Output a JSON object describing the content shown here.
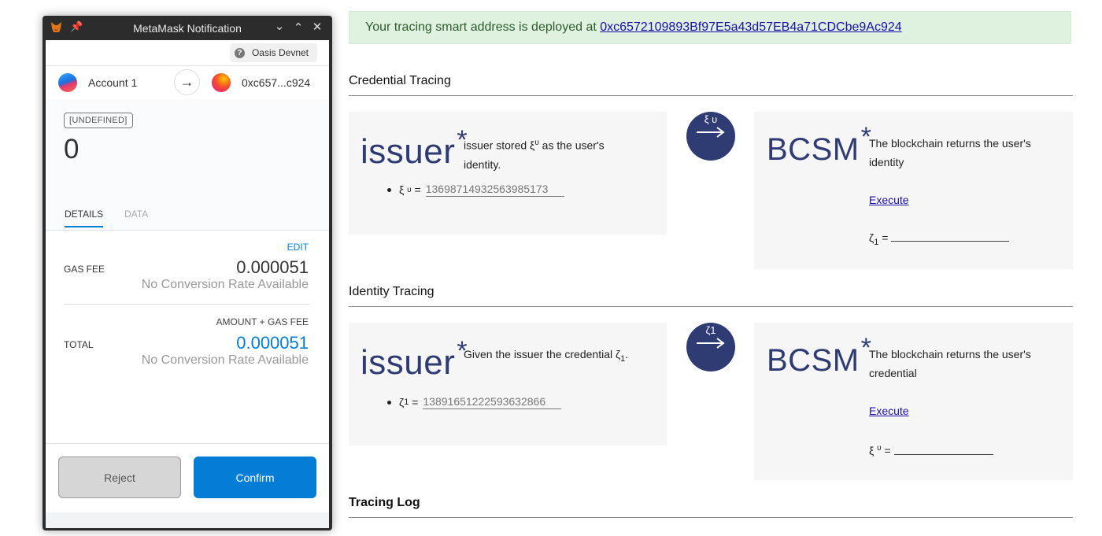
{
  "metamask": {
    "window_title": "MetaMask Notification",
    "network": "Oasis Devnet",
    "from_account": "Account 1",
    "to_address": "0xc657...c924",
    "tx_label": "[UNDEFINED]",
    "amount": "0",
    "tabs": [
      "DETAILS",
      "DATA"
    ],
    "edit_label": "EDIT",
    "gas_fee_label": "GAS FEE",
    "gas_fee_value": "0.000051",
    "no_conversion": "No Conversion Rate Available",
    "amount_gas_label": "AMOUNT + GAS FEE",
    "total_label": "TOTAL",
    "total_value": "0.000051",
    "reject_label": "Reject",
    "confirm_label": "Confirm",
    "accent_color": "#037dd6"
  },
  "alert": {
    "text": "Your tracing smart address is deployed at ",
    "address": "0xc6572109893Bf97E5a43d57EB4a71CDCbe9Ac924"
  },
  "credential": {
    "title": "Credential Tracing",
    "issuer_word": "issuer",
    "star": "*",
    "issuer_text_1": "issuer stored ξ",
    "issuer_sup": "υ",
    "issuer_text_2": " as the user's identity.",
    "bullet_symbol": "ξ",
    "bullet_sup": "υ",
    "bullet_eq": "=",
    "bullet_value": "13698714932563985173",
    "arrow_label": "ξ υ",
    "bcsm_word": "BCSM",
    "bcsm_text": "The blockchain returns the user's identity",
    "execute_label": "Execute",
    "result_symbol": "ζ",
    "result_sub": "1",
    "result_eq": "="
  },
  "identity": {
    "title": "Identity Tracing",
    "issuer_word": "issuer",
    "star": "*",
    "issuer_text_1": "Given the issuer the credential ζ",
    "issuer_sub": "1",
    "issuer_text_2": ".",
    "bullet_symbol": "ζ",
    "bullet_sub": "1",
    "bullet_eq": "=",
    "bullet_value": "13891651222593632866",
    "arrow_label": "ζ1",
    "bcsm_word": "BCSM",
    "bcsm_text": "The blockchain returns the user's credential",
    "execute_label": "Execute",
    "result_symbol": "ξ",
    "result_sup": "υ",
    "result_eq": "="
  },
  "log": {
    "title": "Tracing Log"
  },
  "colors": {
    "brand_navy": "#2f3c73",
    "alert_bg": "#dff2df"
  }
}
